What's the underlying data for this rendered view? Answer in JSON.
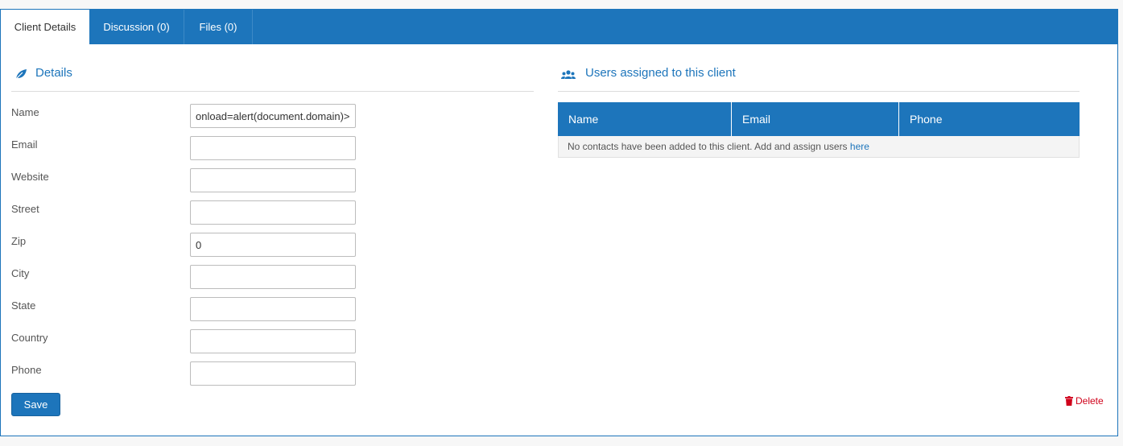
{
  "tabs": [
    {
      "label": "Client Details",
      "active": true
    },
    {
      "label": "Discussion (0)",
      "active": false
    },
    {
      "label": "Files (0)",
      "active": false
    }
  ],
  "details": {
    "heading": "Details",
    "icon": "leaf-icon",
    "fields": [
      {
        "label": "Name",
        "value": "onload=alert(document.domain)>"
      },
      {
        "label": "Email",
        "value": ""
      },
      {
        "label": "Website",
        "value": ""
      },
      {
        "label": "Street",
        "value": ""
      },
      {
        "label": "Zip",
        "value": "0"
      },
      {
        "label": "City",
        "value": ""
      },
      {
        "label": "State",
        "value": ""
      },
      {
        "label": "Country",
        "value": ""
      },
      {
        "label": "Phone",
        "value": ""
      }
    ],
    "save_label": "Save"
  },
  "users": {
    "heading": "Users assigned to this client",
    "icon": "users-icon",
    "columns": [
      "Name",
      "Email",
      "Phone"
    ],
    "empty_text": "No contacts have been added to this client. Add and assign users ",
    "empty_link": "here"
  },
  "delete_label": "Delete",
  "colors": {
    "primary": "#1d75bb",
    "danger": "#d0021b"
  }
}
